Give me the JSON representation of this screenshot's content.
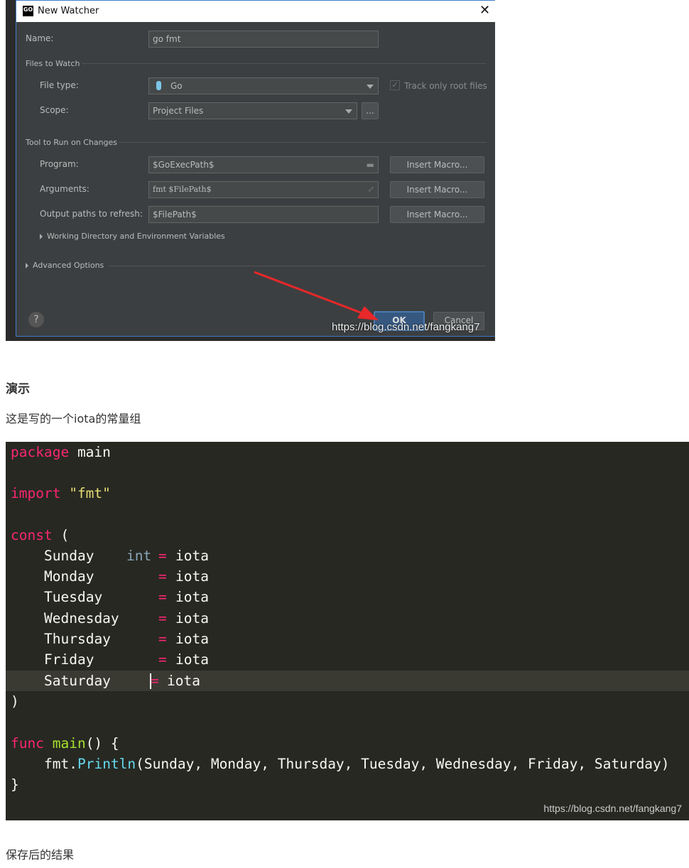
{
  "dialog": {
    "title": "New Watcher",
    "name_label": "Name:",
    "name_value": "go fmt",
    "files_section": "Files to Watch",
    "file_type_label": "File type:",
    "file_type_value": "Go",
    "track_root_label": "Track only root files",
    "track_root_checked": true,
    "scope_label": "Scope:",
    "scope_value": "Project Files",
    "scope_more": "...",
    "tool_section": "Tool to Run on Changes",
    "program_label": "Program:",
    "program_value": "$GoExecPath$",
    "arguments_label": "Arguments:",
    "arguments_value": "fmt $FilePath$",
    "output_label": "Output paths to refresh:",
    "output_value": "$FilePath$",
    "insert_macro": "Insert Macro...",
    "working_dir": "Working Directory and Environment Variables",
    "advanced": "Advanced Options",
    "help": "?",
    "ok": "OK",
    "cancel": "Cancel",
    "watermark": "https://blog.csdn.net/fangkang7",
    "accent": "#3d7cc9",
    "arrow_color": "#e8282a"
  },
  "heading": "演示",
  "intro": "这是写的一个iota的常量组",
  "code": {
    "watermark": "https://blog.csdn.net/fangkang7",
    "const_names": [
      "Sunday",
      "Monday",
      "Tuesday",
      "Wednesday",
      "Thursday",
      "Friday",
      "Saturday"
    ],
    "kw_package": "package",
    "pkg_name": "main",
    "kw_import": "import",
    "import_path": "\"fmt\"",
    "kw_const": "const",
    "type_int": "int",
    "iota": "iota",
    "kw_func": "func",
    "fn_main": "main",
    "pkg_fmt": "fmt",
    "fn_println": "Println",
    "println_args": "(Sunday, Monday, Thursday, Tuesday, Wednesday, Friday, Saturday)"
  },
  "after": "保存后的结果"
}
